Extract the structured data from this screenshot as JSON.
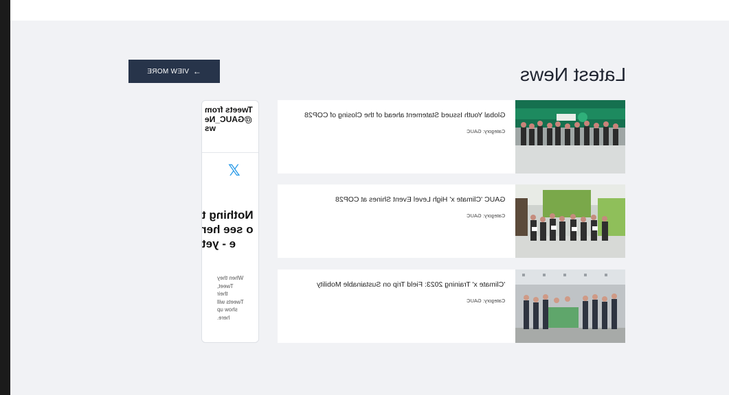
{
  "header": {
    "section_title": "Latest News",
    "view_more_label": "VIEW MORE",
    "view_more_icon": "arrow-left-icon"
  },
  "news": [
    {
      "title": "Global Youth Issued Statement ahead of the Closing of COP28",
      "category": "Category: GAUC",
      "image_description": "group-photo-cop28-stage"
    },
    {
      "title": "GAUC 'Climate x' High Level Event Shines at COP28",
      "category": "Category: GAUC",
      "image_description": "group-photo-certificates"
    },
    {
      "title": "'Climate x' Training 2023: Field Trip on Sustainable Mobility",
      "category": "Category: GAUC",
      "image_description": "group-photo-banner"
    }
  ],
  "tweets": {
    "header": "Tweets from @GAUC_News",
    "icon": "x-logo-icon",
    "empty_title": "Nothing to see here - yet",
    "empty_subtitle": "When they Tweet, their Tweets will show up here."
  },
  "colors": {
    "button_bg": "#27344a",
    "page_bg": "#f1f2f5",
    "x_blue": "#2a9be8"
  }
}
